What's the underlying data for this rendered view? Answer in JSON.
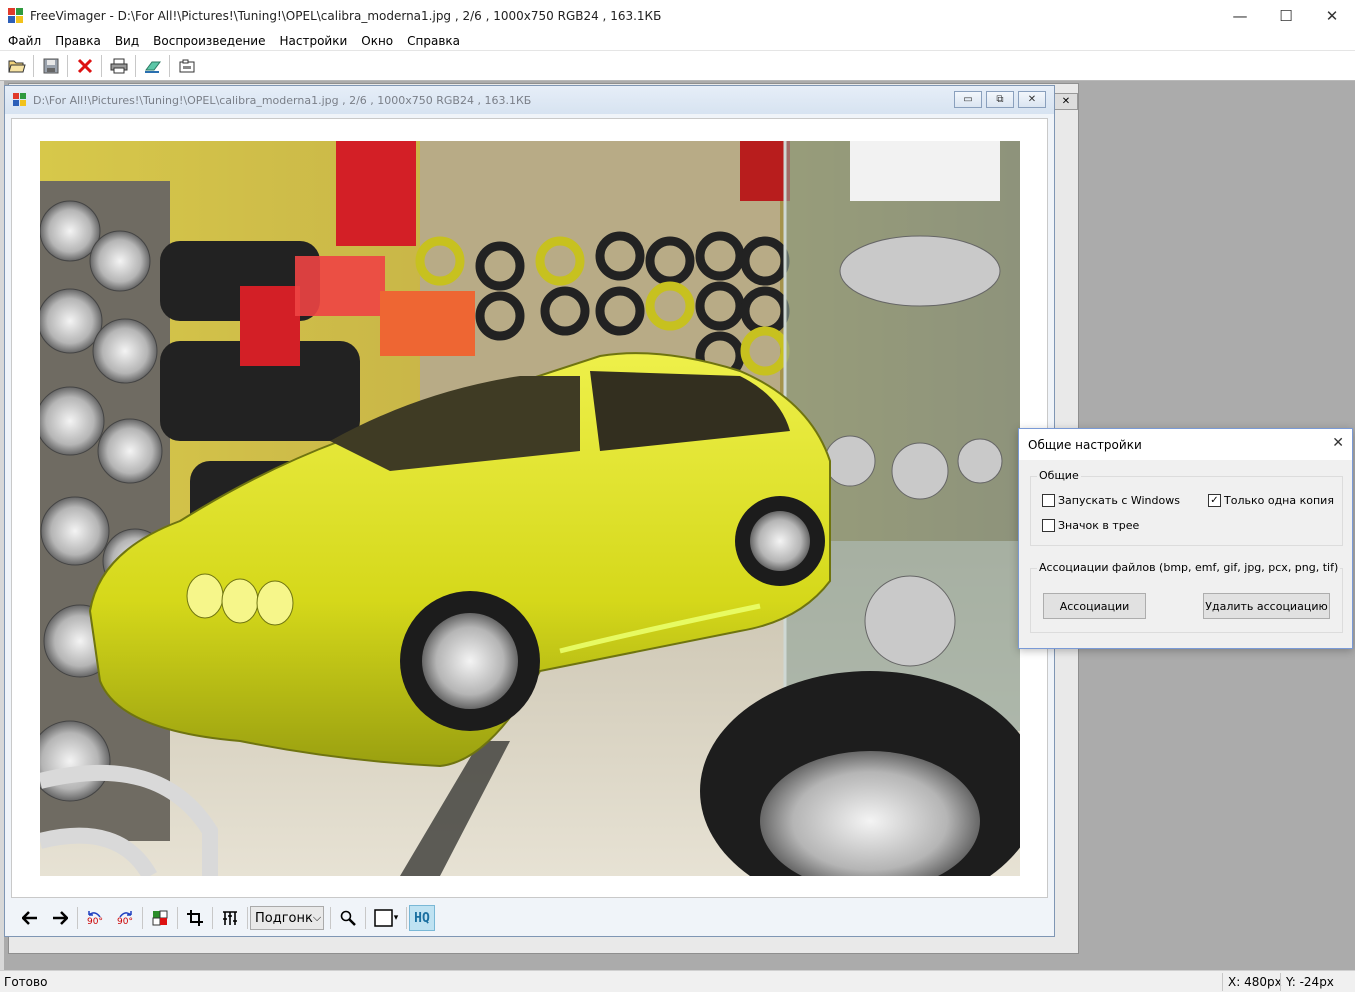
{
  "window": {
    "title": "FreeVimager - D:\\For All!\\Pictures!\\Tuning!\\OPEL\\calibra_moderna1.jpg , 2/6 , 1000x750 RGB24 , 163.1КБ",
    "minimize": "—",
    "maximize": "☐",
    "close": "✕"
  },
  "menu": [
    "Файл",
    "Правка",
    "Вид",
    "Воспроизведение",
    "Настройки",
    "Окно",
    "Справка"
  ],
  "toolbar": {
    "open": "📂",
    "save": "💾",
    "delete": "✕",
    "print": "🖶",
    "scan": "✉",
    "capture": "📷"
  },
  "child": {
    "title": "D:\\For All!\\Pictures!\\Tuning!\\OPEL\\calibra_moderna1.jpg , 2/6 , 1000x750 RGB24 , 163.1КБ",
    "minimize": "▭",
    "restore": "⧉",
    "close": "✕",
    "ghost_close": "✕"
  },
  "bottom_toolbar": {
    "prev": "🡐",
    "next": "🡒",
    "rot_left": "90°",
    "rot_right": "90°",
    "fit_label": "Подгонк",
    "fit_arrow": "⌵",
    "zoom": "🔍",
    "bg_arrow": "▾",
    "hq": "HQ"
  },
  "dialog": {
    "title": "Общие настройки",
    "close": "✕",
    "group_general": "Общие",
    "chk_startup": "Запускать с Windows",
    "chk_startup_checked": false,
    "chk_single": "Только одна копия",
    "chk_single_checked": true,
    "chk_tray": "Значок в трее",
    "chk_tray_checked": false,
    "group_assoc": "Ассоциации файлов (bmp, emf, gif, jpg, pcx, png, tif)",
    "btn_assoc": "Ассоциации",
    "btn_remove": "Удалить ассоциацию"
  },
  "status": {
    "text": "Готово",
    "x": "X: 480px",
    "y": "Y: -24px"
  },
  "colors": {
    "car": "#d9dc1a",
    "mdi_bg": "#ababab"
  }
}
